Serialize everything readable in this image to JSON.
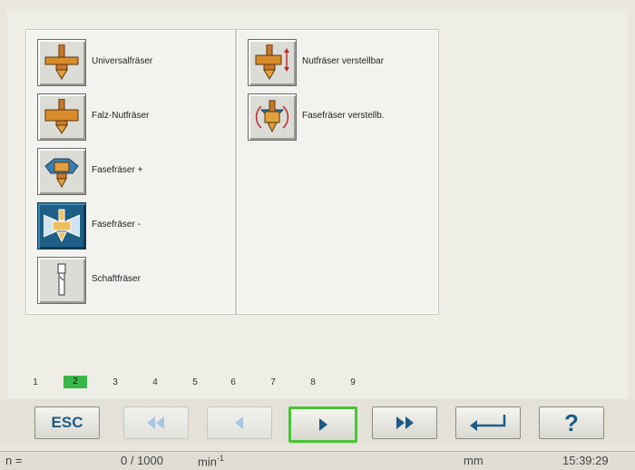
{
  "tools_left": [
    {
      "label": "Universalfräser",
      "icon": "universal-cutter-icon",
      "active": false
    },
    {
      "label": "Falz-Nutfräser",
      "icon": "rebate-groove-cutter-icon",
      "active": false
    },
    {
      "label": "Fasefräser +",
      "icon": "chamfer-cutter-plus-icon",
      "active": false
    },
    {
      "label": "Fasefräser -",
      "icon": "chamfer-cutter-minus-icon",
      "active": true
    },
    {
      "label": "Schaftfräser",
      "icon": "shank-cutter-icon",
      "active": false
    }
  ],
  "tools_right": [
    {
      "label": "Nutfräser verstellbar",
      "icon": "adjustable-groove-cutter-icon"
    },
    {
      "label": "Fasefräser verstellb.",
      "icon": "adjustable-chamfer-cutter-icon"
    }
  ],
  "pages": [
    "1",
    "2",
    "3",
    "4",
    "5",
    "6",
    "7",
    "8",
    "9"
  ],
  "current_page": "2",
  "toolbar": {
    "esc_label": "ESC",
    "help_label": "?"
  },
  "status": {
    "n_label": "n =",
    "speed_value": "0 / 1000",
    "speed_unit": "min",
    "speed_unit_exp": "-1",
    "unit": "mm",
    "time": "15:39:29"
  },
  "colors": {
    "accent_blue": "#1d5b86",
    "focus_green": "#49c438",
    "page_highlight": "#39b54a"
  }
}
